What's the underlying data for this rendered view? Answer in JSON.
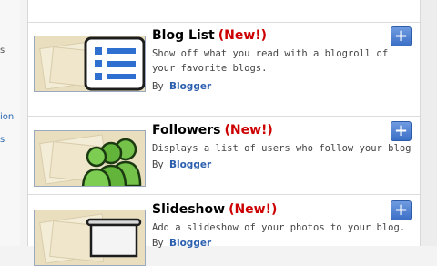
{
  "sidebar_fragments": [
    "s",
    "ion",
    "s"
  ],
  "gadgets": [
    {
      "title": "Blog List",
      "new_badge": "(New!)",
      "description": "Show off what you read with a blogroll of your favorite blogs.",
      "by_label": "By",
      "author": "Blogger",
      "add_label": "+",
      "icon": "list-icon"
    },
    {
      "title": "Followers",
      "new_badge": "(New!)",
      "description": "Displays a list of users who follow your blog",
      "by_label": "By",
      "author": "Blogger",
      "add_label": "+",
      "icon": "users-icon"
    },
    {
      "title": "Slideshow",
      "new_badge": "(New!)",
      "description": "Add a slideshow of your photos to your blog.",
      "by_label": "By",
      "author": "Blogger",
      "add_label": "+",
      "icon": "projector-screen-icon"
    }
  ],
  "colors": {
    "new_badge": "#cc0000",
    "author_link": "#2b5fae",
    "add_button": "#3b6fc7"
  }
}
